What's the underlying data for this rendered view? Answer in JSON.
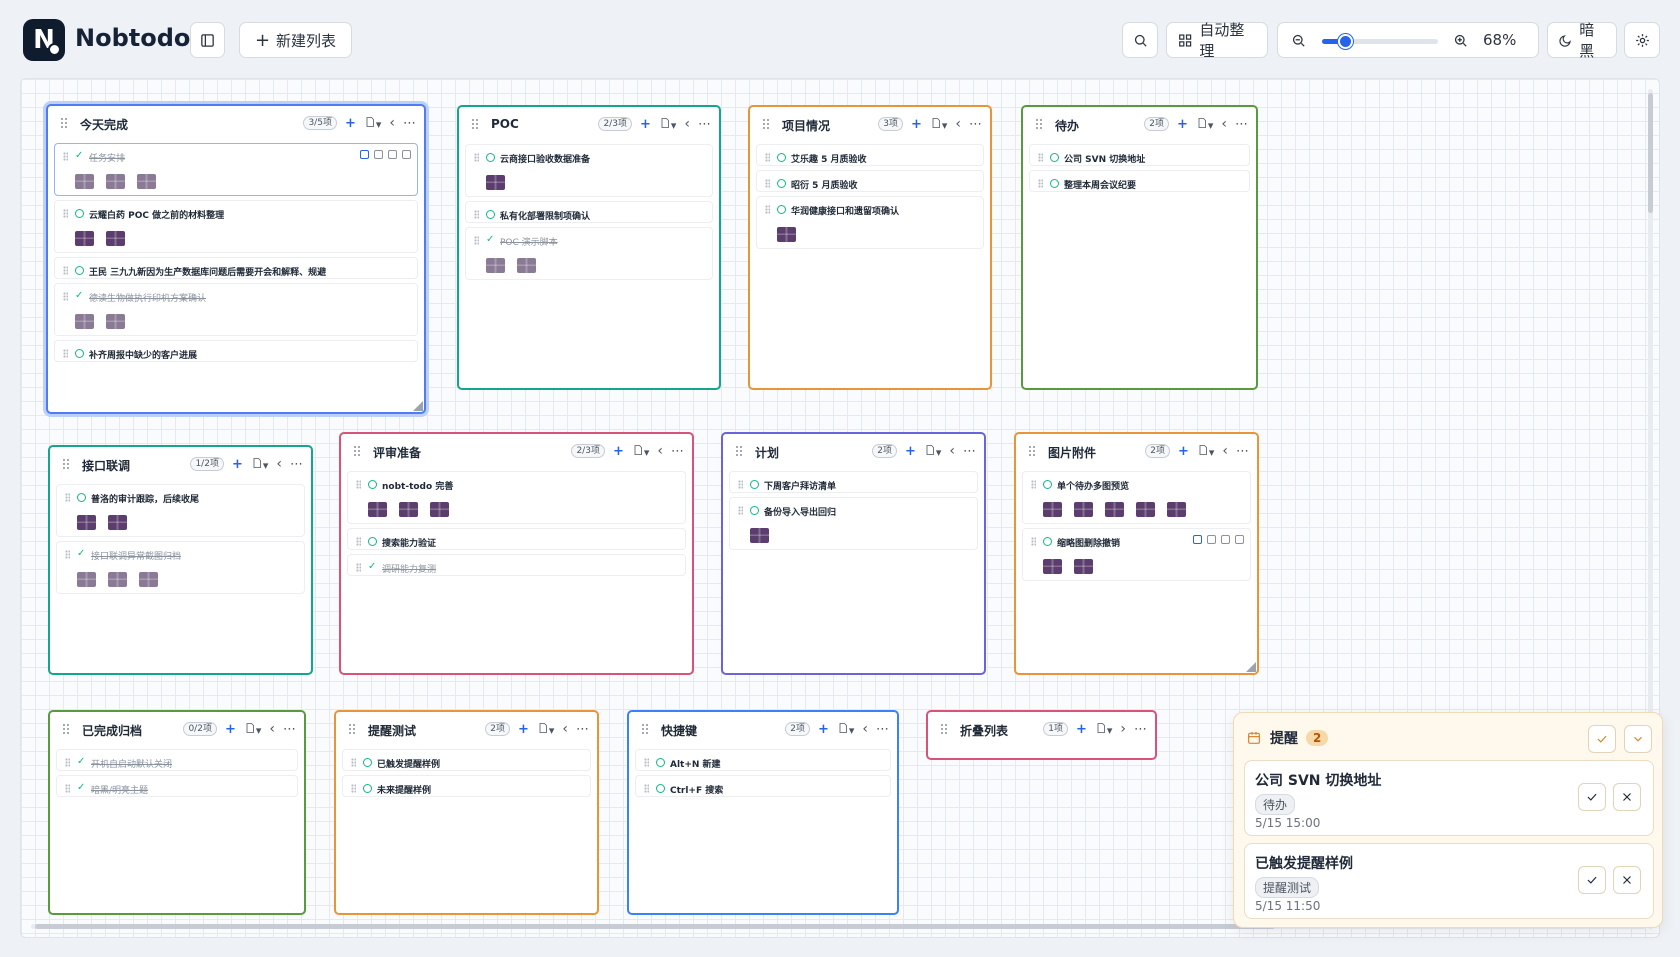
{
  "app": {
    "logo_letter": "N",
    "name": "Nobtodo"
  },
  "toolbar": {
    "new_list": "新建列表",
    "auto_arrange": "自动整理",
    "zoom_value": "68%",
    "zoom_fraction": 0.2,
    "theme": "暗黑"
  },
  "colors": {
    "accent": "#2563eb",
    "check": "#10b981"
  },
  "lists": [
    {
      "title": "今天完成",
      "count": "3/5项",
      "color": "#4f7cf0",
      "tasks": [
        {
          "text": "任务安排",
          "done": true,
          "thumbs": 3
        },
        {
          "text": "云耀白药 POC 做之前的材料整理",
          "done": false,
          "thumbs": 2
        },
        {
          "text": "王民 三九九新因为生产数据库问题后需要开会和解释、规避",
          "done": false,
          "thumbs": 0
        },
        {
          "text": "德读生物做执行印机方案确认",
          "done": true,
          "thumbs": 2
        },
        {
          "text": "补齐周报中缺少的客户进展",
          "done": false,
          "thumbs": 0
        }
      ]
    },
    {
      "title": "POC",
      "count": "2/3项",
      "color": "#15a58a",
      "tasks": [
        {
          "text": "云商接口验收数据准备",
          "done": false,
          "thumbs": 1
        },
        {
          "text": "私有化部署限制项确认",
          "done": false,
          "thumbs": 0
        },
        {
          "text": "POC 演示脚本",
          "done": true,
          "thumbs": 2
        }
      ]
    },
    {
      "title": "项目情况",
      "count": "3项",
      "color": "#e8953a",
      "tasks": [
        {
          "text": "艾乐趣 5 月质验收",
          "done": false,
          "thumbs": 0
        },
        {
          "text": "昭衍 5 月质验收",
          "done": false,
          "thumbs": 0
        },
        {
          "text": "华润健康接口和遗留项确认",
          "done": false,
          "thumbs": 1
        }
      ]
    },
    {
      "title": "待办",
      "count": "2项",
      "color": "#5a9a3e",
      "tasks": [
        {
          "text": "公司 SVN 切换地址",
          "done": false,
          "thumbs": 0
        },
        {
          "text": "整理本周会议纪要",
          "done": false,
          "thumbs": 0
        }
      ]
    },
    {
      "title": "接口联调",
      "count": "1/2项",
      "color": "#15a58a",
      "tasks": [
        {
          "text": "普洛的审计跟踪，后续收尾",
          "done": false,
          "thumbs": 2
        },
        {
          "text": "接口联调异常截图归档",
          "done": true,
          "thumbs": 3
        }
      ]
    },
    {
      "title": "评审准备",
      "count": "2/3项",
      "color": "#d8527a",
      "tasks": [
        {
          "text": "nobt-todo 完善",
          "done": false,
          "thumbs": 3
        },
        {
          "text": "搜索能力验证",
          "done": false,
          "thumbs": 0
        },
        {
          "text": "调研能力复测",
          "done": true,
          "thumbs": 0
        }
      ]
    },
    {
      "title": "计划",
      "count": "2项",
      "color": "#6b63d9",
      "tasks": [
        {
          "text": "下周客户拜访清单",
          "done": false,
          "thumbs": 0
        },
        {
          "text": "备份导入导出回归",
          "done": false,
          "thumbs": 1
        }
      ]
    },
    {
      "title": "图片附件",
      "count": "2项",
      "color": "#e8953a",
      "tasks": [
        {
          "text": "单个待办多图预览",
          "done": false,
          "thumbs": 5
        },
        {
          "text": "缩略图删除撤销",
          "done": false,
          "thumbs": 2
        }
      ]
    },
    {
      "title": "已完成归档",
      "count": "0/2项",
      "color": "#5a9a3e",
      "tasks": [
        {
          "text": "开机自启动默认关闭",
          "done": true,
          "thumbs": 0
        },
        {
          "text": "暗黑/明亮主题",
          "done": true,
          "thumbs": 0
        }
      ]
    },
    {
      "title": "提醒测试",
      "count": "2项",
      "color": "#e8953a",
      "tasks": [
        {
          "text": "已触发提醒样例",
          "done": false,
          "thumbs": 0
        },
        {
          "text": "未来提醒样例",
          "done": false,
          "thumbs": 0
        }
      ]
    },
    {
      "title": "快捷键",
      "count": "2项",
      "color": "#3b82f6",
      "tasks": [
        {
          "text": "Alt+N 新建",
          "done": false,
          "thumbs": 0
        },
        {
          "text": "Ctrl+F 搜索",
          "done": false,
          "thumbs": 0
        }
      ]
    },
    {
      "title": "折叠列表",
      "count": "1项",
      "color": "#d8527a",
      "tasks": []
    }
  ],
  "reminders": {
    "title": "提醒",
    "count": "2",
    "items": [
      {
        "title": "公司 SVN 切换地址",
        "tag": "待办",
        "time": "5/15 15:00"
      },
      {
        "title": "已触发提醒样例",
        "tag": "提醒测试",
        "time": "5/15 11:50"
      }
    ]
  }
}
